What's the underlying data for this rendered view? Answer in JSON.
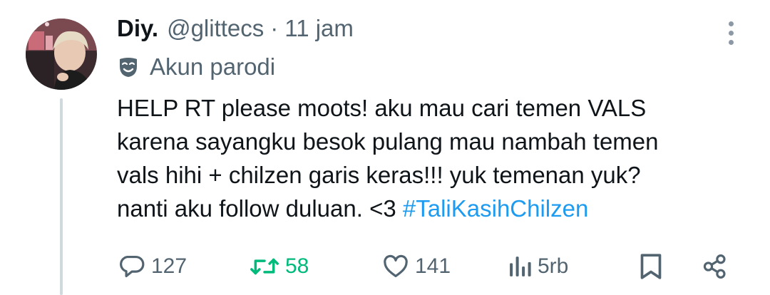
{
  "tweet": {
    "display_name": "Diy.",
    "handle": "@glittecs",
    "separator": "·",
    "time": "11 jam",
    "parody_label": "Akun parodi",
    "text_lines": [
      "HELP RT please moots! aku mau cari temen VALS",
      "karena sayangku besok pulang mau nambah temen",
      "vals hihi + chilzen garis keras!!! yuk temenan yuk?",
      "nanti aku follow duluan. <3 "
    ],
    "hashtag": "#TaliKasihChilzen"
  },
  "actions": {
    "replies": "127",
    "retweets": "58",
    "likes": "141",
    "views": "5rb"
  },
  "colors": {
    "accent": "#1d9bf0",
    "retweet_green": "#00ba7c",
    "secondary_text": "#536471",
    "thread_line": "#cfd9de"
  },
  "icons": [
    "more-vertical-icon",
    "parody-mask-icon",
    "reply-icon",
    "retweet-icon",
    "like-icon",
    "views-icon",
    "bookmark-icon",
    "share-icon"
  ]
}
